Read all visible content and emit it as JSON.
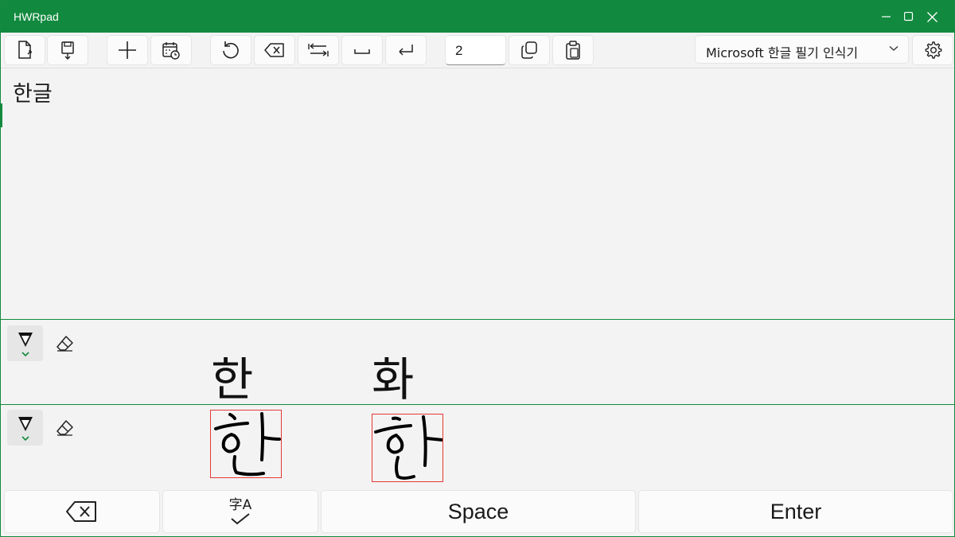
{
  "window": {
    "title": "HWRpad"
  },
  "toolbar": {
    "count_value": "2",
    "recognizer": "Microsoft 한글 필기 인식기"
  },
  "editor": {
    "text": "한글"
  },
  "candidates": [
    "한",
    "화"
  ],
  "keys": {
    "space": "Space",
    "enter": "Enter",
    "convert_glyph": "字A"
  },
  "colors": {
    "accent": "#118a3f",
    "ink_box": "#e53935"
  }
}
